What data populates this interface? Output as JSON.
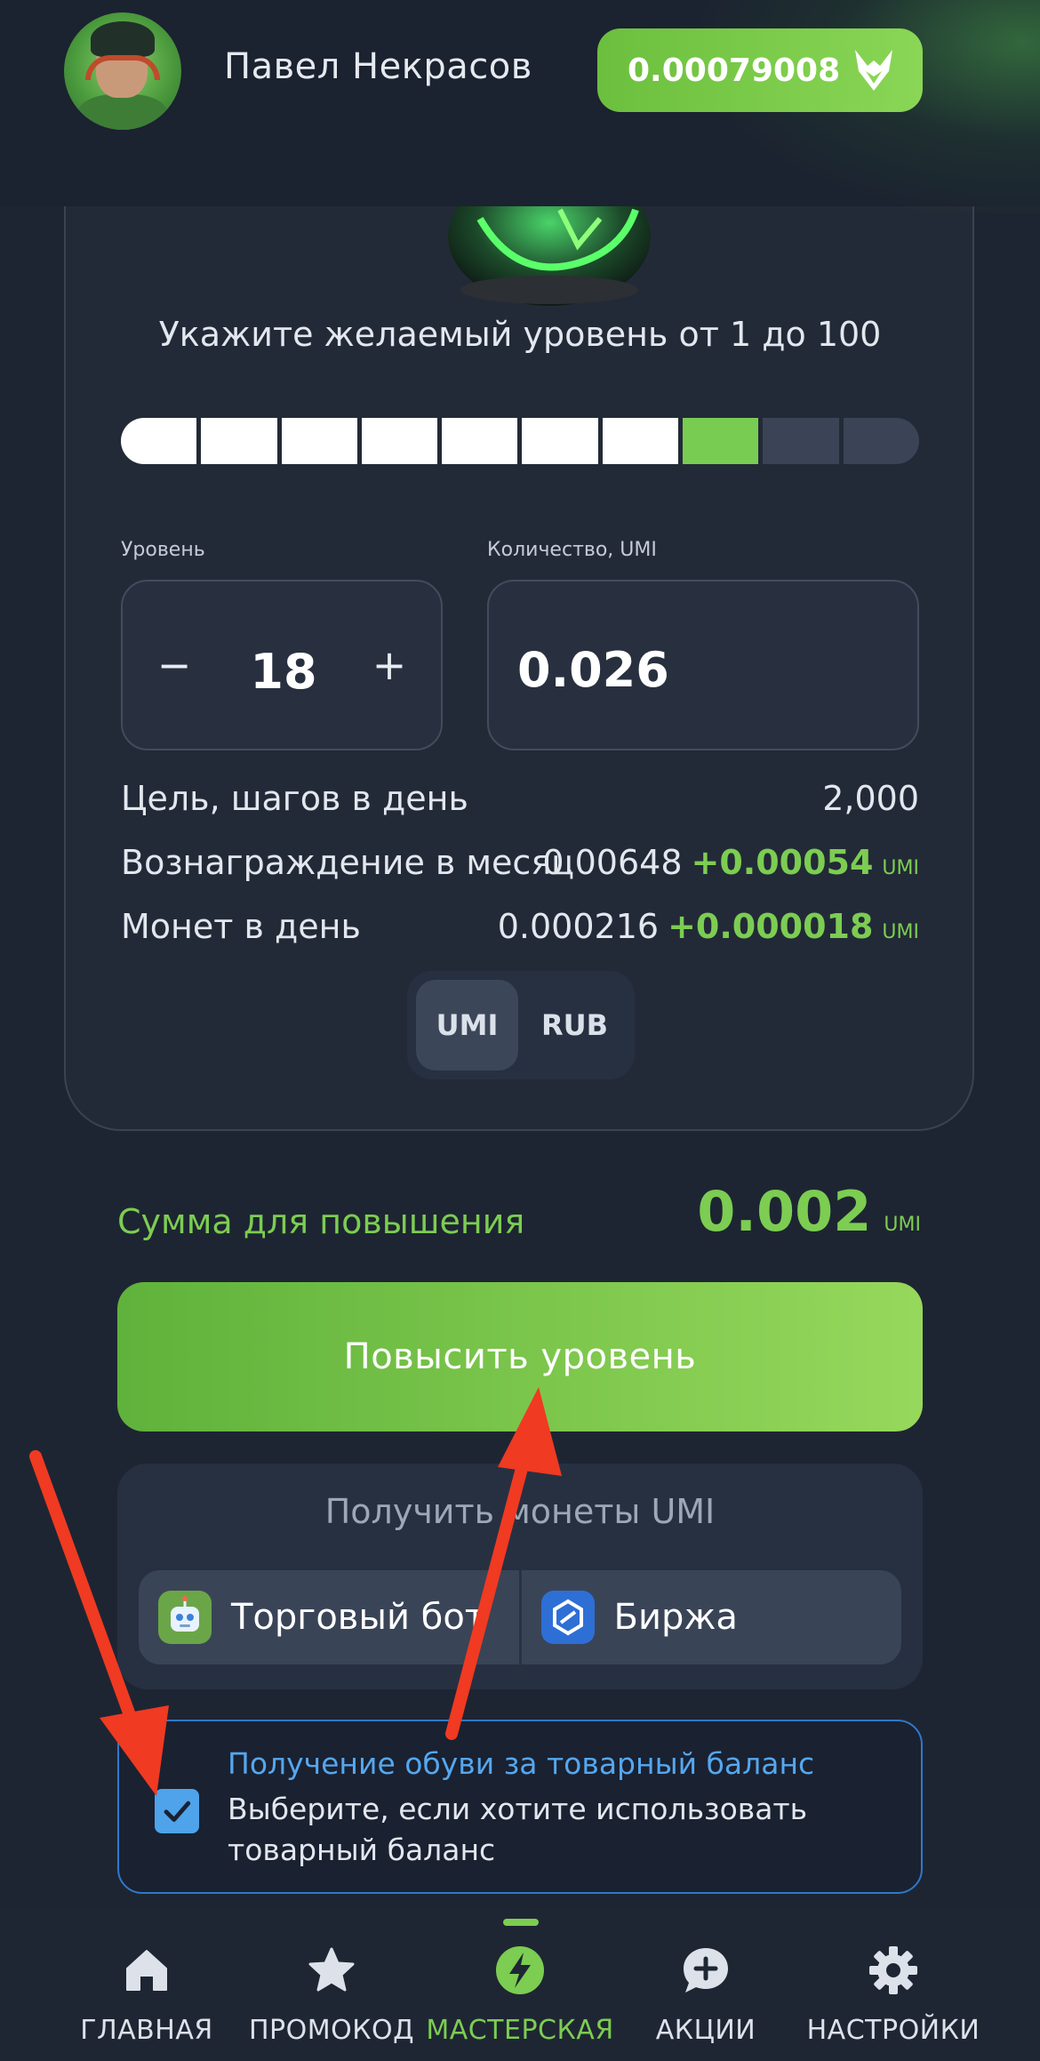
{
  "header": {
    "user_name": "Павел Некрасов",
    "balance": "0.00079008"
  },
  "level_card": {
    "hint": "Укажите желаемый уровень от 1 до 100",
    "progress_segments": 10,
    "progress_filled": 7,
    "progress_current_index": 7,
    "level_label": "Уровень",
    "level_value": "18",
    "minus_symbol": "−",
    "plus_symbol": "+",
    "amount_label": "Количество, UMI",
    "amount_value": "0.026",
    "stats": [
      {
        "label": "Цель, шагов в день",
        "value": "2,000",
        "delta": "",
        "unit": ""
      },
      {
        "label": "Вознаграждение в месяц",
        "value": "0.00648",
        "delta": "+0.00054",
        "unit": "UMI"
      },
      {
        "label": "Монет в день",
        "value": "0.000216",
        "delta": "+0.000018",
        "unit": "UMI"
      }
    ],
    "currency_options": [
      "UMI",
      "RUB"
    ],
    "currency_selected": "UMI"
  },
  "upgrade": {
    "sum_label": "Сумма для повышения",
    "sum_value": "0.002",
    "sum_unit": "UMI",
    "button_label": "Повысить уровень"
  },
  "get_coins": {
    "title": "Получить монеты UMI",
    "buttons": [
      {
        "label": "Торговый бот",
        "icon": "robot-icon"
      },
      {
        "label": "Биржа",
        "icon": "exchange-icon"
      }
    ]
  },
  "balance_option": {
    "title": "Получение обуви за товарный баланс",
    "description": "Выберите, если хотите использовать товарный баланс",
    "checked": true
  },
  "bottom_nav": [
    {
      "label": "ГЛАВНАЯ",
      "icon": "home-icon",
      "active": false
    },
    {
      "label": "ПРОМОКОД",
      "icon": "star-icon",
      "active": false
    },
    {
      "label": "МАСТЕРСКАЯ",
      "icon": "lightning-icon",
      "active": true
    },
    {
      "label": "АКЦИИ",
      "icon": "chat-plus-icon",
      "active": false
    },
    {
      "label": "НАСТРОЙКИ",
      "icon": "gear-icon",
      "active": false
    }
  ],
  "colors": {
    "accent_green": "#7ccd52",
    "accent_blue": "#55a7ee",
    "background": "#1e2532",
    "annotation_red": "#f03a22"
  }
}
